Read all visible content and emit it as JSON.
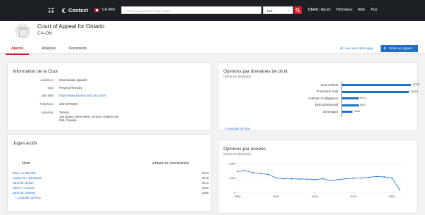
{
  "topbar": {
    "logo": "Context",
    "region": "CA (FR)",
    "search_placeholder": "Saisir le nom d'entité / page ou sujet",
    "scope": "Tout",
    "nav": {
      "client_label": "Client :",
      "client_value": "Aucun",
      "history": "Historique",
      "help": "Aide",
      "more": "Plus"
    }
  },
  "court": {
    "name": "Court of Appeal for Ontario",
    "code": "CA-ON"
  },
  "tabs": [
    "Aperçu",
    "Analyses",
    "Documents"
  ],
  "actions": {
    "link_page": "Lien vers cette page",
    "create_report": "Créer un rapport"
  },
  "info": {
    "title": "Information de la Cour",
    "rows": [
      {
        "label": "Juridiction",
        "value": "Intermediate Appeals"
      },
      {
        "label": "Type",
        "value": "Province/Territory"
      },
      {
        "label": "Site Web",
        "value": "https://www.ontariocourts.ca/coa/en"
      },
      {
        "label": "Téléphone",
        "value": "416-327-5020"
      },
      {
        "label": "Adresses",
        "value": "Toronto",
        "value2": "130 Queen Street West, Toronto, Ontario n5h",
        "value3": "2n5, Canada"
      }
    ]
  },
  "judges": {
    "title": "Juges Actifs",
    "col_name": "Nom",
    "col_year": "Année de nomination",
    "rows": [
      {
        "name": "Mary Lou Benotto",
        "year": "2013"
      },
      {
        "name": "Lawrence I. Blackman",
        "year": "2018"
      },
      {
        "name": "David M. Brown",
        "year": "2014"
      },
      {
        "name": "Steve A. Coroza",
        "year": "2020"
      },
      {
        "name": "David M. Doherty",
        "year": "1990"
      }
    ],
    "more": "+ Consulter 20 Plus"
  },
  "domains": {
    "title": "Opinions par domaines de droit",
    "subtitle": "(Selon les décisions)",
    "more": "+ Consulter 43 Plus",
    "chart_data": {
      "type": "bar",
      "orientation": "horizontal",
      "categories": [
        "Droit criminel",
        "Procédure civile",
        "Contrats et obligations",
        "Droit administratif",
        "Dommages"
      ],
      "values": [
        25259,
        24569,
        6212,
        6097,
        3965
      ],
      "labels": [
        "25259",
        "24569",
        "6212",
        "6097",
        "3965"
      ],
      "xlim": [
        0,
        25259
      ]
    }
  },
  "years": {
    "title": "Opinions par années",
    "subtitle": "(Selon les décisions)",
    "chart_data": {
      "type": "line",
      "x": [
        2000,
        2001,
        2002,
        2003,
        2004,
        2005,
        2006,
        2007,
        2008,
        2009,
        2010,
        2011,
        2012,
        2013,
        2014,
        2015,
        2016,
        2017,
        2018,
        2019,
        2020,
        2021
      ],
      "y": [
        1450,
        1500,
        1380,
        1300,
        1250,
        1000,
        950,
        940,
        930,
        920,
        880,
        950,
        830,
        880,
        950,
        980,
        1000,
        1050,
        1100,
        1080,
        1000,
        200
      ],
      "xticks": [
        2000,
        2005,
        2010,
        2015,
        2020
      ],
      "yticks": [
        0,
        1000,
        2000
      ],
      "xlim": [
        2000,
        2022
      ],
      "ylim": [
        0,
        2000
      ],
      "grid": true
    }
  }
}
